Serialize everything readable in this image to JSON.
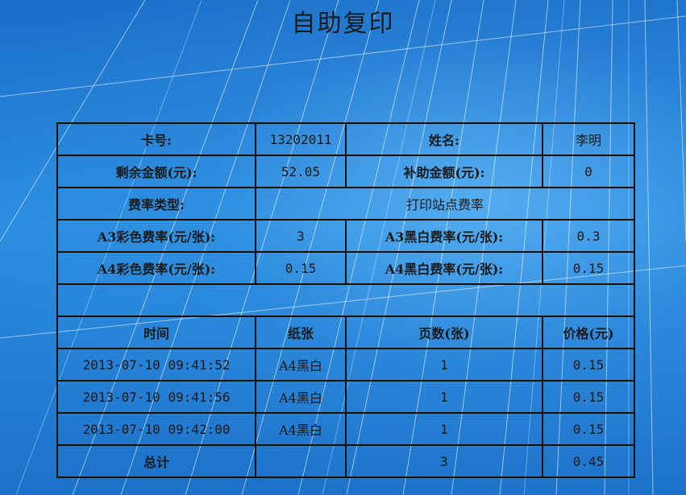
{
  "title": "自助复印",
  "card": {
    "card_no_label": "卡号:",
    "card_no_value": "13202011",
    "name_label": "姓名:",
    "name_value": "李明",
    "balance_label": "剩余金额(元):",
    "balance_value": "52.05",
    "subsidy_label": "补助金额(元):",
    "subsidy_value": "0",
    "rate_type_label": "费率类型:",
    "rate_type_value": "打印站点费率",
    "a3_color_label": "A3彩色费率(元/张):",
    "a3_color_value": "3",
    "a3_bw_label": "A3黑白费率(元/张):",
    "a3_bw_value": "0.3",
    "a4_color_label": "A4彩色费率(元/张):",
    "a4_color_value": "0.15",
    "a4_bw_label": "A4黑白费率(元/张):",
    "a4_bw_value": "0.15"
  },
  "records": {
    "headers": [
      "时间",
      "纸张",
      "页数(张)",
      "价格(元)"
    ],
    "rows": [
      {
        "time": "2013-07-10 09:41:52",
        "paper": "A4黑白",
        "pages": "1",
        "price": "0.15"
      },
      {
        "time": "2013-07-10 09:41:56",
        "paper": "A4黑白",
        "pages": "1",
        "price": "0.15"
      },
      {
        "time": "2013-07-10 09:42:00",
        "paper": "A4黑白",
        "pages": "1",
        "price": "0.15"
      }
    ],
    "total_label": "总计",
    "total_pages": "3",
    "total_price": "0.45"
  }
}
